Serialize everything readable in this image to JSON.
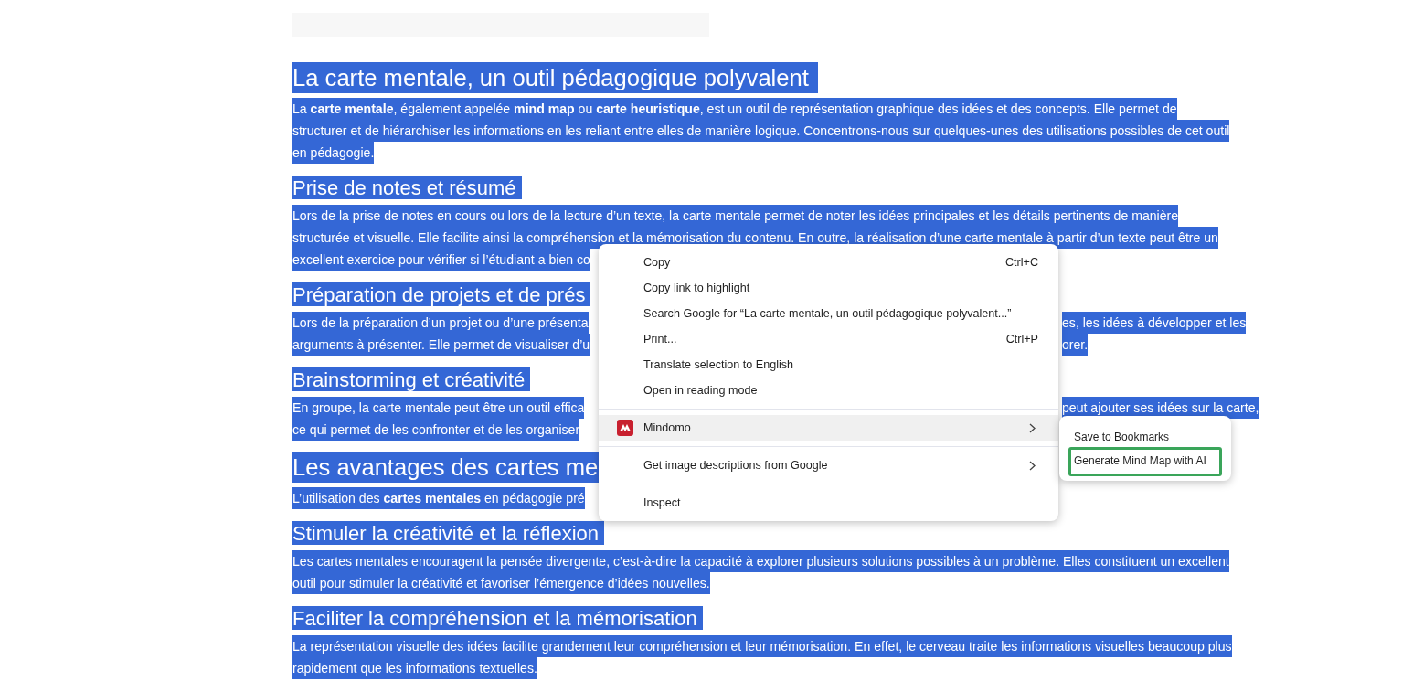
{
  "article": {
    "selection_active": true,
    "blocks": [
      {
        "kind": "title",
        "text": "La carte mentale, un outil pédagogique polyvalent"
      },
      {
        "kind": "paragraph",
        "lines": [
          {
            "left": "La **carte mentale**, également appelée **mind map** ou **carte heuristique**, est un outil de représentation graphique des idées et des concepts. Elle permet de"
          },
          {
            "left": "structurer et de hiérarchiser les informations en les reliant entre elles de manière logique. Concentrons-nous sur quelques-unes des utilisations possibles de cet outil"
          },
          {
            "left": "en pédagogie."
          }
        ]
      },
      {
        "kind": "subtitle",
        "text": "Prise de notes et résumé"
      },
      {
        "kind": "paragraph",
        "lines": [
          {
            "left": "Lors de la prise de notes en cours ou lors de la lecture d’un texte, la carte mentale permet de noter les idées principales et les détails pertinents de manière"
          },
          {
            "left": "structurée et visuelle. Elle facilite ainsi la compréhension et la mémorisation du contenu. En outre, la réalisation d’une carte mentale à partir d’un texte peut être un"
          },
          {
            "left": "excellent exercice pour vérifier si l’étudiant a bien co"
          }
        ]
      },
      {
        "kind": "subtitle",
        "text": "Préparation de projets et de prés"
      },
      {
        "kind": "paragraph",
        "lines": [
          {
            "left": "Lors de la préparation d’un projet ou d’une présenta",
            "right": "es, les idées à développer et les"
          },
          {
            "left": "arguments à présenter. Elle permet de visualiser d’u",
            "right": "orer."
          }
        ]
      },
      {
        "kind": "subtitle",
        "text": "Brainstorming et créativité"
      },
      {
        "kind": "paragraph",
        "lines": [
          {
            "left": "En groupe, la carte mentale peut être un outil effica",
            "right": "peut ajouter ses idées sur la carte,"
          },
          {
            "left": "ce qui permet de les confronter et de les organiser"
          }
        ]
      },
      {
        "kind": "title",
        "text": "Les avantages des cartes me"
      },
      {
        "kind": "paragraph",
        "lines": [
          {
            "left": "L’utilisation des **cartes mentales** en pédagogie pré"
          }
        ]
      },
      {
        "kind": "subtitle",
        "text": "Stimuler la créativité et la réflexion"
      },
      {
        "kind": "paragraph",
        "lines": [
          {
            "left": "Les cartes mentales encouragent la pensée divergente, c’est-à-dire la capacité à explorer plusieurs solutions possibles à un problème. Elles constituent un excellent"
          },
          {
            "left": "outil pour stimuler la créativité et favoriser l’émergence d’idées nouvelles."
          }
        ]
      },
      {
        "kind": "subtitle",
        "text": "Faciliter la compréhension et la mémorisation"
      },
      {
        "kind": "paragraph",
        "lines": [
          {
            "left": "La représentation visuelle des idées facilite grandement leur compréhension et leur mémorisation. En effet, le cerveau traite les informations visuelles beaucoup plus"
          },
          {
            "left": "rapidement que les informations textuelles."
          }
        ]
      }
    ]
  },
  "context_menu": {
    "items": [
      {
        "kind": "item",
        "label": "Copy",
        "shortcut": "Ctrl+C",
        "highlighted": false
      },
      {
        "kind": "item",
        "label": "Copy link to highlight",
        "highlighted": false
      },
      {
        "kind": "item",
        "label": "Search Google for “La carte mentale, un outil pédagogique polyvalent...”",
        "highlighted": false
      },
      {
        "kind": "item",
        "label": "Print...",
        "shortcut": "Ctrl+P",
        "highlighted": false
      },
      {
        "kind": "item",
        "label": "Translate selection to English",
        "highlighted": false
      },
      {
        "kind": "item",
        "label": "Open in reading mode",
        "highlighted": false
      },
      {
        "kind": "separator"
      },
      {
        "kind": "extension",
        "label": "Mindomo",
        "highlighted": true
      },
      {
        "kind": "separator"
      },
      {
        "kind": "submenu",
        "label": "Get image descriptions from Google",
        "highlighted": false
      },
      {
        "kind": "separator"
      },
      {
        "kind": "item",
        "label": "Inspect",
        "highlighted": false
      }
    ]
  },
  "submenu": {
    "items": [
      {
        "label": "Save to Bookmarks",
        "outlined": false
      },
      {
        "label": "Generate Mind Map with AI",
        "outlined": true
      }
    ]
  }
}
